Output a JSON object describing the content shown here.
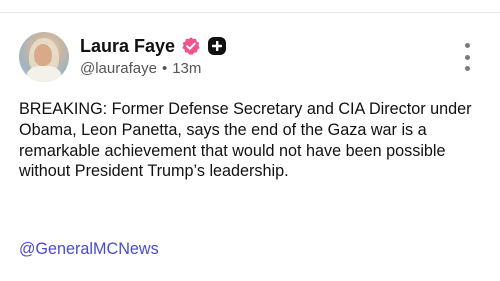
{
  "post": {
    "author": {
      "display_name": "Laura Faye",
      "handle": "@laurafaye",
      "separator": "•",
      "time_ago": "13m",
      "verified_badge_color": "#f0548c",
      "plus_badge_color": "#111111"
    },
    "body": "BREAKING: Former Defense Secretary and CIA Director under Obama, Leon Panetta, says the end of the Gaza war is a remarkable achievement that would not have been possible without President Trump’s leadership.",
    "mention": "@GeneralMCNews",
    "mention_color": "#4a4ad0",
    "icons": {
      "verified": "verified-check-icon",
      "plus": "plus-badge-icon",
      "more": "more-vertical-icon"
    }
  }
}
